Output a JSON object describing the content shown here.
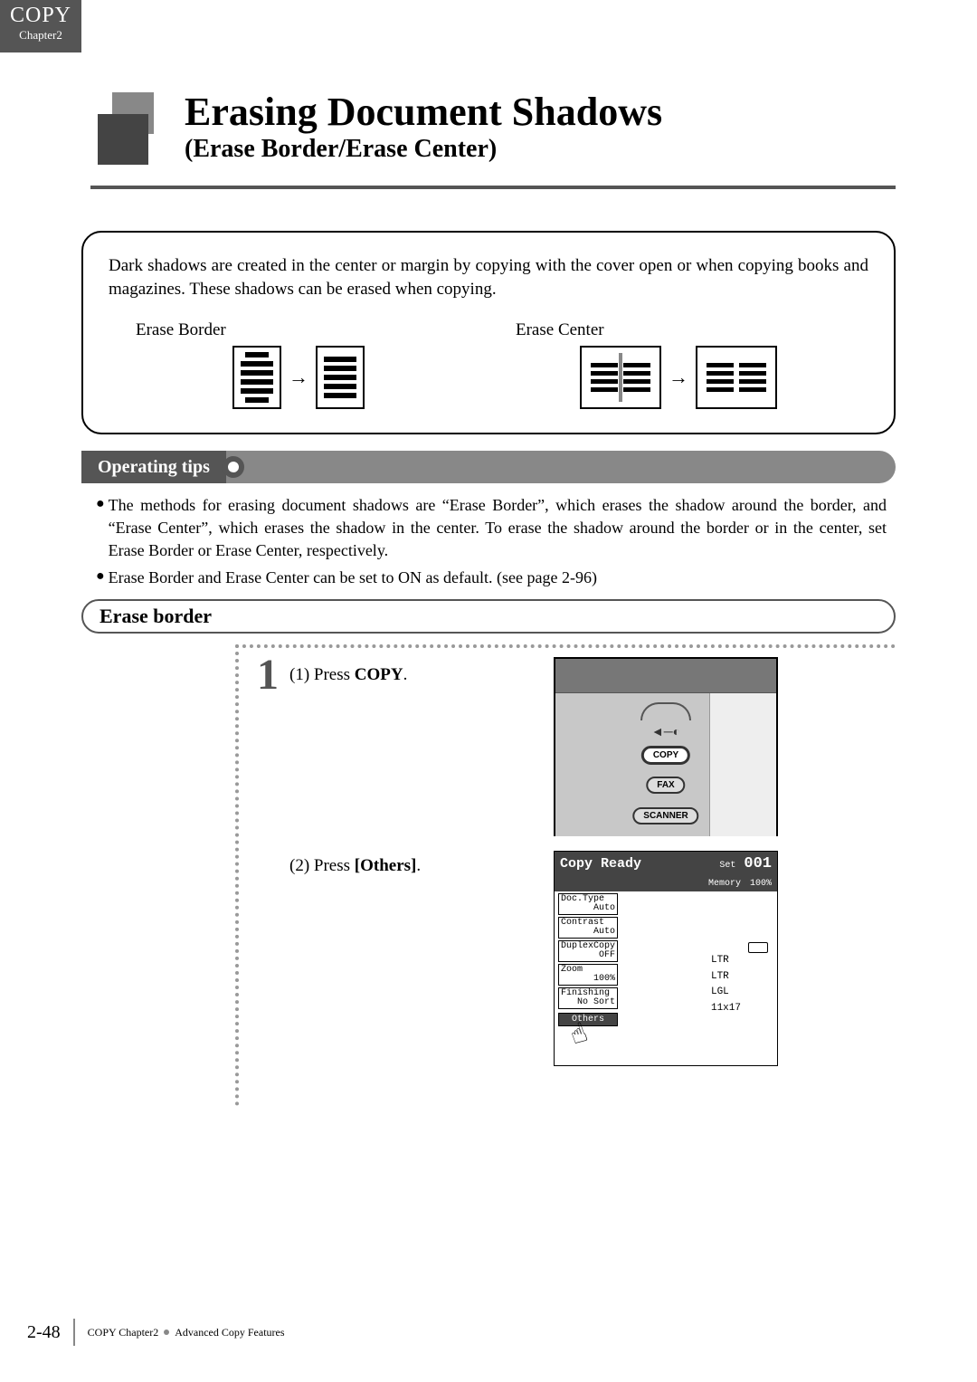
{
  "chapter_tab": {
    "title": "COPY",
    "sub": "Chapter2"
  },
  "title": {
    "main": "Erasing Document Shadows",
    "sub": "(Erase Border/Erase Center)"
  },
  "intro": "Dark shadows are created in the center or margin by copying with the cover open or when copying books and magazines. These shadows can be erased when copying.",
  "diagrams": {
    "border_label": "Erase Border",
    "center_label": "Erase Center"
  },
  "tips": {
    "header": "Operating tips",
    "items": [
      "The methods for erasing document shadows are “Erase Border”, which erases the shadow around the border, and “Erase Center”, which erases the shadow in the center. To erase the shadow around the border or in the center, set Erase Border or Erase Center, respectively.",
      "Erase Border and Erase Center can be set to ON as default. (see page 2-96)"
    ]
  },
  "section_header": "Erase border",
  "steps": {
    "num1": "1",
    "text1_prefix": "(1) Press ",
    "text1_bold": "COPY",
    "text1_suffix": ".",
    "text2_prefix": "(2) Press ",
    "text2_bold": "[Others]",
    "text2_suffix": "."
  },
  "device": {
    "copy": "COPY",
    "fax": "FAX",
    "scanner": "SCANNER"
  },
  "lcd": {
    "title": "Copy Ready",
    "set_label": "Set",
    "set_count": "001",
    "memory_label": "Memory",
    "memory_pct": "100%",
    "rows": [
      {
        "k": "Doc.Type",
        "v": "Auto"
      },
      {
        "k": "Contrast",
        "v": "Auto"
      },
      {
        "k": "DuplexCopy",
        "v": "OFF"
      },
      {
        "k": "Zoom",
        "v": "100%"
      },
      {
        "k": "Finishing",
        "v": "No Sort"
      }
    ],
    "others": "Others",
    "sizes": [
      "LTR",
      "LTR",
      "LGL",
      "11x17"
    ]
  },
  "footer": {
    "page": "2-48",
    "crumb1": "COPY Chapter2",
    "crumb2": "Advanced Copy Features"
  }
}
